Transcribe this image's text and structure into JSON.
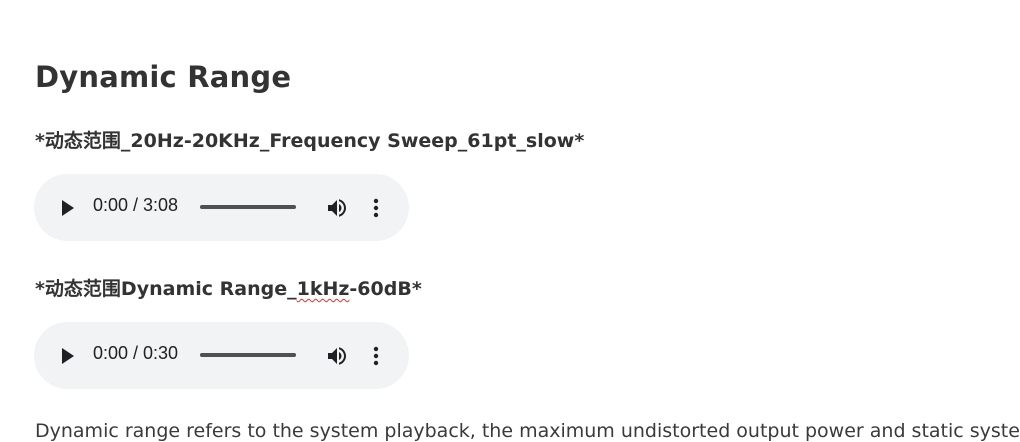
{
  "page": {
    "title": "Dynamic Range",
    "description": "Dynamic range refers to the system playback, the maximum undistorted output power and static system n"
  },
  "tracks": [
    {
      "title": "*动态范围_20Hz-20KHz_Frequency Sweep_61pt_slow*",
      "time": "0:00 / 3:08",
      "progress": 0
    },
    {
      "title_prefix": "*动态范围Dynamic Range_",
      "title_flagged": "1kHz",
      "title_suffix": "-60dB*",
      "time": "0:00 / 0:30",
      "progress": 0
    }
  ],
  "player_controls": {
    "play_icon": "play-icon",
    "volume_icon": "volume-icon",
    "menu_icon": "more-vert-icon"
  },
  "colors": {
    "player_bg": "#f1f3f4",
    "seek_track": "#c4c4c4",
    "seek_fill": "#505050",
    "spellcheck": "#e03030"
  }
}
